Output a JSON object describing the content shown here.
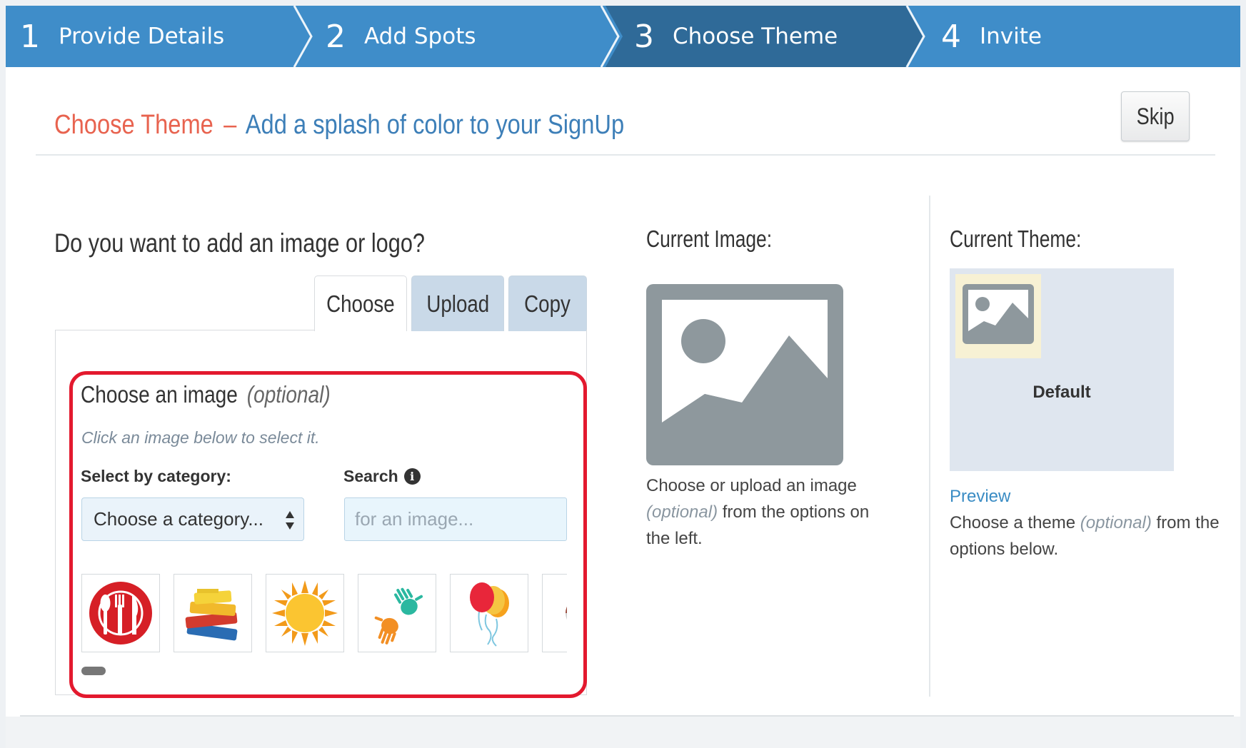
{
  "steps": [
    {
      "number": "1",
      "label": "Provide Details"
    },
    {
      "number": "2",
      "label": "Add Spots"
    },
    {
      "number": "3",
      "label": "Choose Theme"
    },
    {
      "number": "4",
      "label": "Invite"
    }
  ],
  "active_step": 3,
  "colors": {
    "step_bar": "#3f8dc9",
    "step_active": "#2f6a98",
    "heading_accent": "#e8634f",
    "heading_sub": "#3d7fb8",
    "highlight_border": "#e3192e",
    "link": "#3a8cc4"
  },
  "header": {
    "title": "Choose Theme",
    "dash": "–",
    "subtitle": "Add a splash of color to your SignUp",
    "skip_label": "Skip"
  },
  "image_section": {
    "question": "Do you want to add an image or logo?",
    "tabs": [
      {
        "label": "Choose",
        "active": true
      },
      {
        "label": "Upload",
        "active": false
      },
      {
        "label": "Copy",
        "active": false
      }
    ],
    "choose_title": "Choose an image",
    "choose_optional": "(optional)",
    "hint": "Click an image below to select it.",
    "category_label": "Select by category:",
    "category_value": "Choose a category...",
    "search_label": "Search",
    "search_placeholder": "for an image...",
    "thumbnails": [
      "utensils-icon",
      "books-icon",
      "sun-icon",
      "handprints-icon",
      "balloons-icon",
      "partial-image-icon"
    ]
  },
  "current_image": {
    "label": "Current Image:",
    "desc_1": "Choose or upload an image",
    "desc_optional": "(optional)",
    "desc_2": "from the options on the left."
  },
  "current_theme": {
    "label": "Current Theme:",
    "theme_name": "Default",
    "preview_label": "Preview",
    "desc_1": "Choose a theme",
    "desc_optional": "(optional)",
    "desc_2": "from the options below."
  }
}
